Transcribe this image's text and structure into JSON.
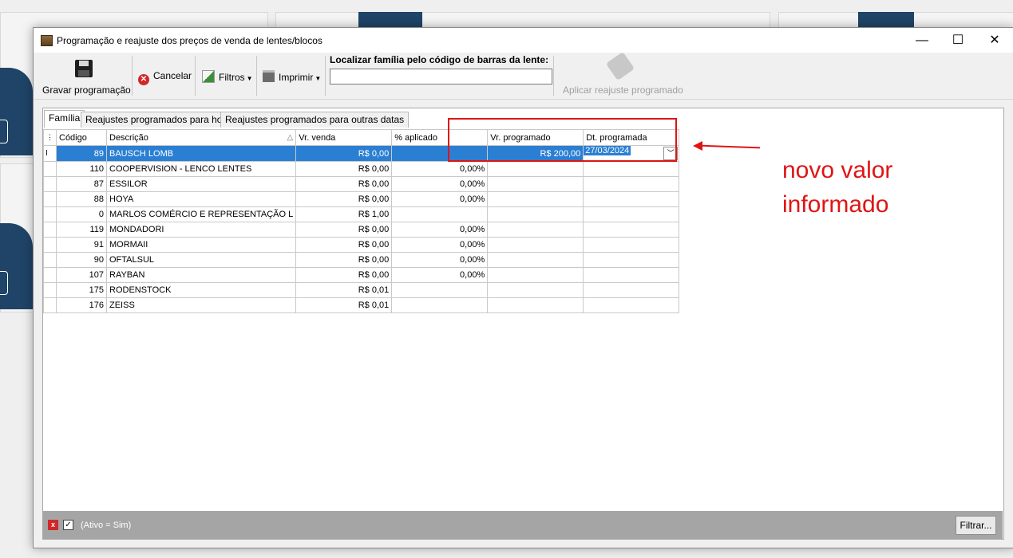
{
  "window": {
    "title": "Programação e reajuste dos preços de venda de lentes/blocos",
    "controls": {
      "minimize": "—",
      "maximize": "☐",
      "close": "✕"
    }
  },
  "toolbar": {
    "save_label": "Gravar programação",
    "cancel_label": "Cancelar",
    "filters_label": "Filtros",
    "print_label": "Imprimir",
    "search_label": "Localizar família pelo código de barras da lente:",
    "search_value": "",
    "apply_label": "Aplicar reajuste programado"
  },
  "tabs": [
    {
      "label": "Família"
    },
    {
      "label": "Reajustes programados para hoje"
    },
    {
      "label": "Reajustes programados para outras datas"
    }
  ],
  "grid": {
    "columns": [
      "Código",
      "Descrição",
      "Vr. venda",
      "% aplicado",
      "Vr. programado",
      "Dt. programada"
    ],
    "sort_indicator": "△",
    "rows": [
      {
        "codigo": "89",
        "descricao": "BAUSCH LOMB",
        "vr_venda": "R$ 0,00",
        "aplicado": "",
        "vr_programado": "R$ 200,00",
        "dt_programada": "27/03/2024"
      },
      {
        "codigo": "110",
        "descricao": "COOPERVISION  - LENCO LENTES",
        "vr_venda": "R$ 0,00",
        "aplicado": "0,00%",
        "vr_programado": "",
        "dt_programada": ""
      },
      {
        "codigo": "87",
        "descricao": "ESSILOR",
        "vr_venda": "R$ 0,00",
        "aplicado": "0,00%",
        "vr_programado": "",
        "dt_programada": ""
      },
      {
        "codigo": "88",
        "descricao": "HOYA",
        "vr_venda": "R$ 0,00",
        "aplicado": "0,00%",
        "vr_programado": "",
        "dt_programada": ""
      },
      {
        "codigo": "0",
        "descricao": "MARLOS COMÉRCIO E REPRESENTAÇÃO L",
        "vr_venda": "R$ 1,00",
        "aplicado": "",
        "vr_programado": "",
        "dt_programada": ""
      },
      {
        "codigo": "119",
        "descricao": "MONDADORI",
        "vr_venda": "R$ 0,00",
        "aplicado": "0,00%",
        "vr_programado": "",
        "dt_programada": ""
      },
      {
        "codigo": "91",
        "descricao": "MORMAII",
        "vr_venda": "R$ 0,00",
        "aplicado": "0,00%",
        "vr_programado": "",
        "dt_programada": ""
      },
      {
        "codigo": "90",
        "descricao": "OFTALSUL",
        "vr_venda": "R$ 0,00",
        "aplicado": "0,00%",
        "vr_programado": "",
        "dt_programada": ""
      },
      {
        "codigo": "107",
        "descricao": "RAYBAN",
        "vr_venda": "R$ 0,00",
        "aplicado": "0,00%",
        "vr_programado": "",
        "dt_programada": ""
      },
      {
        "codigo": "175",
        "descricao": "RODENSTOCK",
        "vr_venda": "R$ 0,01",
        "aplicado": "",
        "vr_programado": "",
        "dt_programada": ""
      },
      {
        "codigo": "176",
        "descricao": "ZEISS",
        "vr_venda": "R$ 0,01",
        "aplicado": "",
        "vr_programado": "",
        "dt_programada": ""
      }
    ]
  },
  "statusbar": {
    "filter_text": "(Ativo = Sim)",
    "filter_button": "Filtrar..."
  },
  "annotation": {
    "line1": "novo valor",
    "line2": "informado"
  },
  "colors": {
    "selection": "#2b7fd3",
    "annotation": "#e01414",
    "status_bg": "#a5a5a5"
  }
}
